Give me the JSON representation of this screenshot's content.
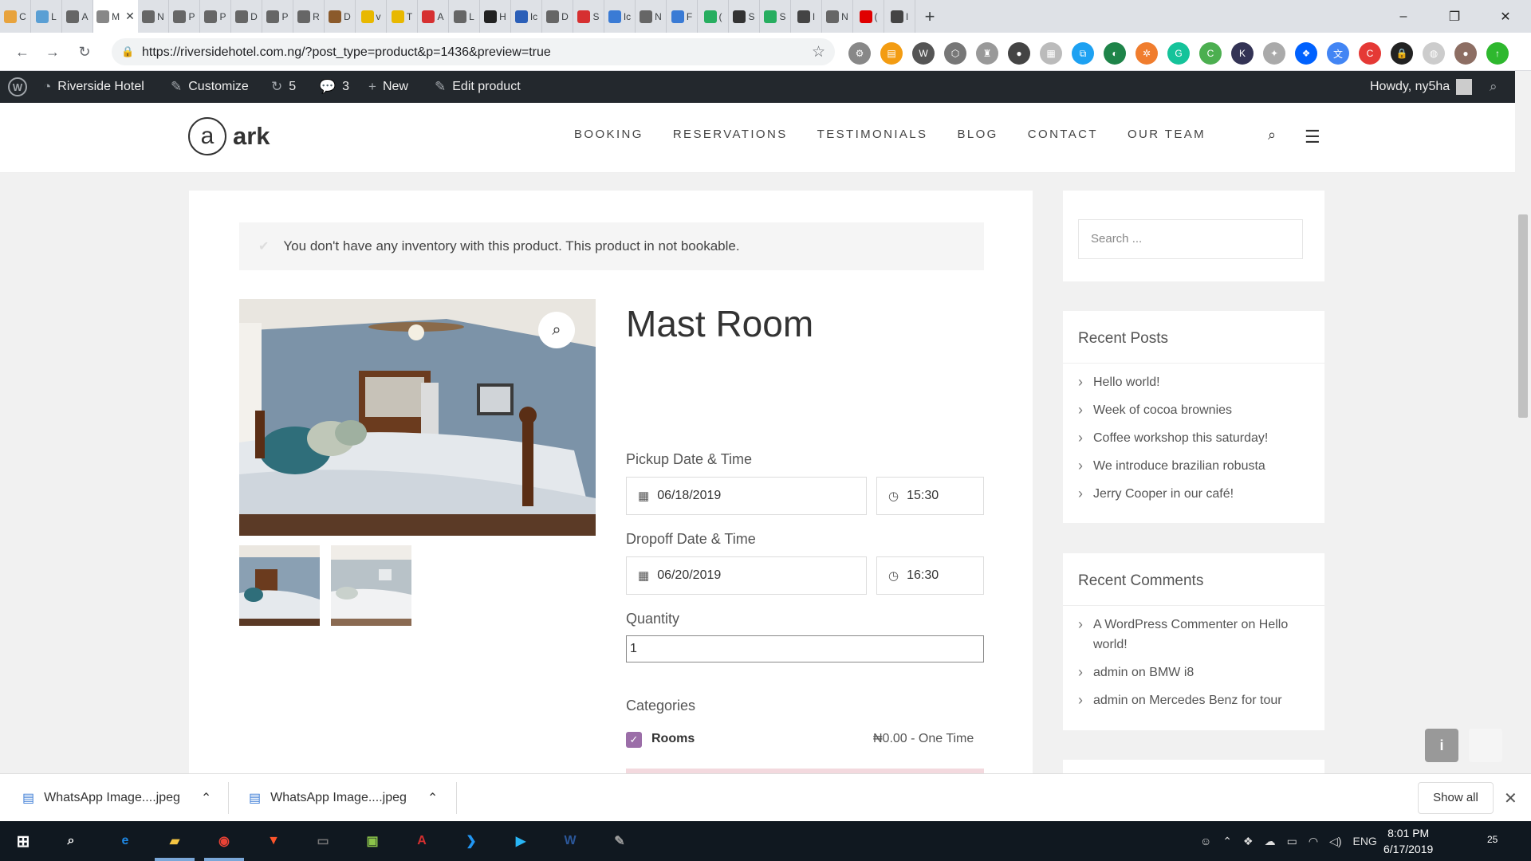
{
  "browser": {
    "tabs": [
      {
        "letter": "C",
        "color": "#e8a33d"
      },
      {
        "letter": "L",
        "color": "#5a9fd4"
      },
      {
        "letter": "A",
        "color": "#666666"
      },
      {
        "letter": "M",
        "color": "#888888",
        "active": true
      },
      {
        "letter": "N",
        "color": "#666666"
      },
      {
        "letter": "P",
        "color": "#666666"
      },
      {
        "letter": "P",
        "color": "#666666"
      },
      {
        "letter": "D",
        "color": "#666666"
      },
      {
        "letter": "P",
        "color": "#666666"
      },
      {
        "letter": "R",
        "color": "#666666"
      },
      {
        "letter": "D",
        "color": "#8b5a2b"
      },
      {
        "letter": "v",
        "color": "#e8b800"
      },
      {
        "letter": "T",
        "color": "#e8b800"
      },
      {
        "letter": "A",
        "color": "#d63031"
      },
      {
        "letter": "L",
        "color": "#666666"
      },
      {
        "letter": "H",
        "color": "#222222"
      },
      {
        "letter": "Ic",
        "color": "#2b5fb8"
      },
      {
        "letter": "D",
        "color": "#666666"
      },
      {
        "letter": "S",
        "color": "#d63031"
      },
      {
        "letter": "Ic",
        "color": "#3a7bd5"
      },
      {
        "letter": "N",
        "color": "#666666"
      },
      {
        "letter": "F",
        "color": "#3a7bd5"
      },
      {
        "letter": "(",
        "color": "#27ae60"
      },
      {
        "letter": "S",
        "color": "#333333"
      },
      {
        "letter": "S",
        "color": "#27ae60"
      },
      {
        "letter": "I",
        "color": "#444444"
      },
      {
        "letter": "N",
        "color": "#666666"
      },
      {
        "letter": "(",
        "color": "#e00000"
      },
      {
        "letter": "I",
        "color": "#444444"
      }
    ],
    "new_tab": "+",
    "url": "https://riversidehotel.com.ng/?post_type=product&p=1436&preview=true",
    "extensions": [
      {
        "color": "#888888",
        "glyph": "⚙"
      },
      {
        "color": "#f39c12",
        "glyph": "▤"
      },
      {
        "color": "#555555",
        "glyph": "W"
      },
      {
        "color": "#777777",
        "glyph": "⬡"
      },
      {
        "color": "#999999",
        "glyph": "♜"
      },
      {
        "color": "#444444",
        "glyph": "●"
      },
      {
        "color": "#bbbbbb",
        "glyph": "▦"
      },
      {
        "color": "#1da1f2",
        "glyph": "⧉"
      },
      {
        "color": "#1e8449",
        "glyph": "◐"
      },
      {
        "color": "#f07d2e",
        "glyph": "✲"
      },
      {
        "color": "#15c39a",
        "glyph": "G"
      },
      {
        "color": "#4caf50",
        "glyph": "C"
      },
      {
        "color": "#333355",
        "glyph": "K"
      },
      {
        "color": "#aaaaaa",
        "glyph": "✦"
      },
      {
        "color": "#0061fe",
        "glyph": "❖"
      },
      {
        "color": "#4285f4",
        "glyph": "文"
      },
      {
        "color": "#e53935",
        "glyph": "C"
      },
      {
        "color": "#222222",
        "glyph": "🔒"
      },
      {
        "color": "#cccccc",
        "glyph": "◍"
      },
      {
        "color": "#8d6e63",
        "glyph": "●"
      },
      {
        "color": "#2eb82e",
        "glyph": "↑"
      }
    ]
  },
  "wpbar": {
    "site_name": "Riverside Hotel",
    "customize": "Customize",
    "updates_count": "5",
    "comments_count": "3",
    "new": "New",
    "edit": "Edit product",
    "howdy": "Howdy, ny5ha"
  },
  "header": {
    "logo_letter": "a",
    "logo_text": "ark",
    "nav": [
      "BOOKING",
      "RESERVATIONS",
      "TESTIMONIALS",
      "BLOG",
      "CONTACT",
      "OUR TEAM"
    ]
  },
  "product": {
    "notice": "You don't have any inventory with this product. This product in not bookable.",
    "title": "Mast Room",
    "pickup_label": "Pickup Date & Time",
    "pickup_date": "06/18/2019",
    "pickup_time": "15:30",
    "dropoff_label": "Dropoff Date & Time",
    "dropoff_date": "06/20/2019",
    "dropoff_time": "16:30",
    "quantity_label": "Quantity",
    "quantity": "1",
    "categories_label": "Categories",
    "category_name": "Rooms",
    "category_price": "₦0.00 - One Time"
  },
  "sidebar": {
    "search_placeholder": "Search ...",
    "recent_posts_title": "Recent Posts",
    "recent_posts": [
      "Hello world!",
      "Week of cocoa brownies",
      "Coffee workshop this saturday!",
      "We introduce brazilian robusta",
      "Jerry Cooper in our café!"
    ],
    "recent_comments_title": "Recent Comments",
    "recent_comments": [
      "A WordPress Commenter on Hello world!",
      "admin on BMW i8",
      "admin on Mercedes Benz for tour"
    ]
  },
  "downloads": {
    "items": [
      "WhatsApp Image....jpeg",
      "WhatsApp Image....jpeg"
    ],
    "show_all": "Show all"
  },
  "taskbar": {
    "lang": "ENG",
    "time": "8:01 PM",
    "date": "6/17/2019",
    "notif_count": "25",
    "apps": [
      {
        "name": "edge",
        "glyph": "e",
        "color": "#1e88e5"
      },
      {
        "name": "explorer",
        "glyph": "▰",
        "color": "#f5c542"
      },
      {
        "name": "chrome",
        "glyph": "◉",
        "color": "#e94235"
      },
      {
        "name": "brave",
        "glyph": "▼",
        "color": "#fb542b"
      },
      {
        "name": "terminal",
        "glyph": "▭",
        "color": "#777777"
      },
      {
        "name": "app-green",
        "glyph": "▣",
        "color": "#8bc34a"
      },
      {
        "name": "acrobat",
        "glyph": "A",
        "color": "#d32f2f"
      },
      {
        "name": "vscode",
        "glyph": "❯",
        "color": "#2196f3"
      },
      {
        "name": "remote",
        "glyph": "▶",
        "color": "#29b6f6"
      },
      {
        "name": "word",
        "glyph": "W",
        "color": "#2b579a"
      },
      {
        "name": "paint",
        "glyph": "✎",
        "color": "#9e9e9e"
      }
    ]
  }
}
